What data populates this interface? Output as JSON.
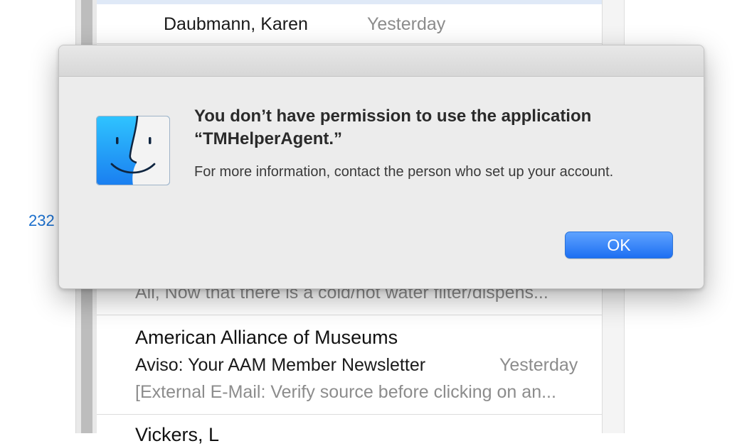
{
  "background": {
    "unread_count": "232",
    "messages": [
      {
        "sender": "Daubmann, Karen",
        "date": "Yesterday"
      },
      {
        "preview": "All, Now that there is a cold/hot water filter/dispens..."
      },
      {
        "sender": "American Alliance of Museums",
        "subject": "Aviso: Your AAM Member Newsletter",
        "date": "Yesterday",
        "preview": "[External E-Mail: Verify source before clicking on an..."
      },
      {
        "sender": "Vickers, L"
      }
    ]
  },
  "alert": {
    "title": "You don’t have permission to use the application “TMHelperAgent.”",
    "body": "For more information, contact the person who set up your account.",
    "ok_label": "OK",
    "icon": "finder-icon"
  },
  "colors": {
    "accent": "#1a6fce",
    "button": "#1d6ff2",
    "dialog_bg": "#ececec"
  }
}
